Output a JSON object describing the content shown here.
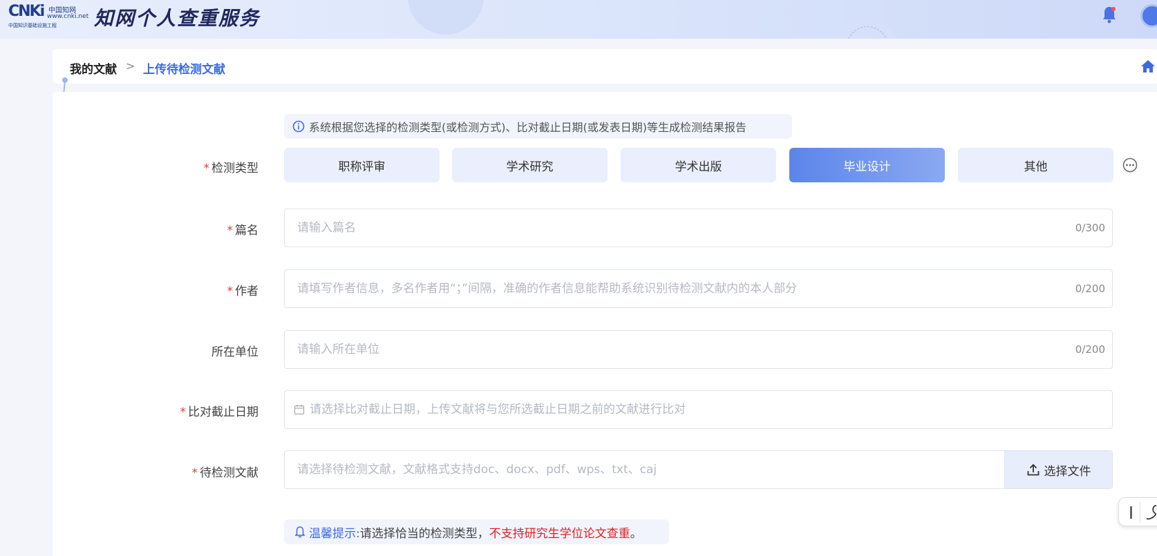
{
  "header": {
    "logo": {
      "mark": "CNKi",
      "cn_name": "中国知网",
      "url": "www.cnki.net",
      "subtitle": "中国知识基础设施工程"
    },
    "title": "知网个人查重服务"
  },
  "breadcrumb": {
    "items": [
      "我的文献",
      "上传待检测文献"
    ],
    "separator": ">"
  },
  "form": {
    "info_tip": "系统根据您选择的检测类型(或检测方式)、比对截止日期(或发表日期)等生成检测结果报告",
    "detection_type": {
      "label": "检测类型",
      "required_mark": "*",
      "options": [
        "职称评审",
        "学术研究",
        "学术出版",
        "毕业设计",
        "其他"
      ],
      "selected": "毕业设计"
    },
    "title_field": {
      "label": "篇名",
      "required_mark": "*",
      "value": "",
      "placeholder": "请输入篇名",
      "counter": "0/300"
    },
    "author_field": {
      "label": "作者",
      "required_mark": "*",
      "value": "",
      "placeholder": "请填写作者信息，多名作者用“；”间隔，准确的作者信息能帮助系统识别待检测文献内的本人部分",
      "counter": "0/200"
    },
    "unit_field": {
      "label": "所在单位",
      "value": "",
      "placeholder": "请输入所在单位",
      "counter": "0/200"
    },
    "date_field": {
      "label": "比对截止日期",
      "required_mark": "*",
      "value": "",
      "placeholder": "请选择比对截止日期，上传文献将与您所选截止日期之前的文献进行比对"
    },
    "file_field": {
      "label": "待检测文献",
      "required_mark": "*",
      "value": "",
      "placeholder": "请选择待检测文献，文献格式支持doc、docx、pdf、wps、txt、caj",
      "button_label": "选择文件"
    },
    "warm_tip": {
      "label": "温馨提示:",
      "text": "请选择恰当的检测类型，",
      "warning": "不支持研究生学位论文查重",
      "end": "。"
    }
  },
  "colors": {
    "accent": "#3c6be0",
    "active_button": "#5b85ea",
    "required": "#e23b3b",
    "warning": "#e02020"
  }
}
